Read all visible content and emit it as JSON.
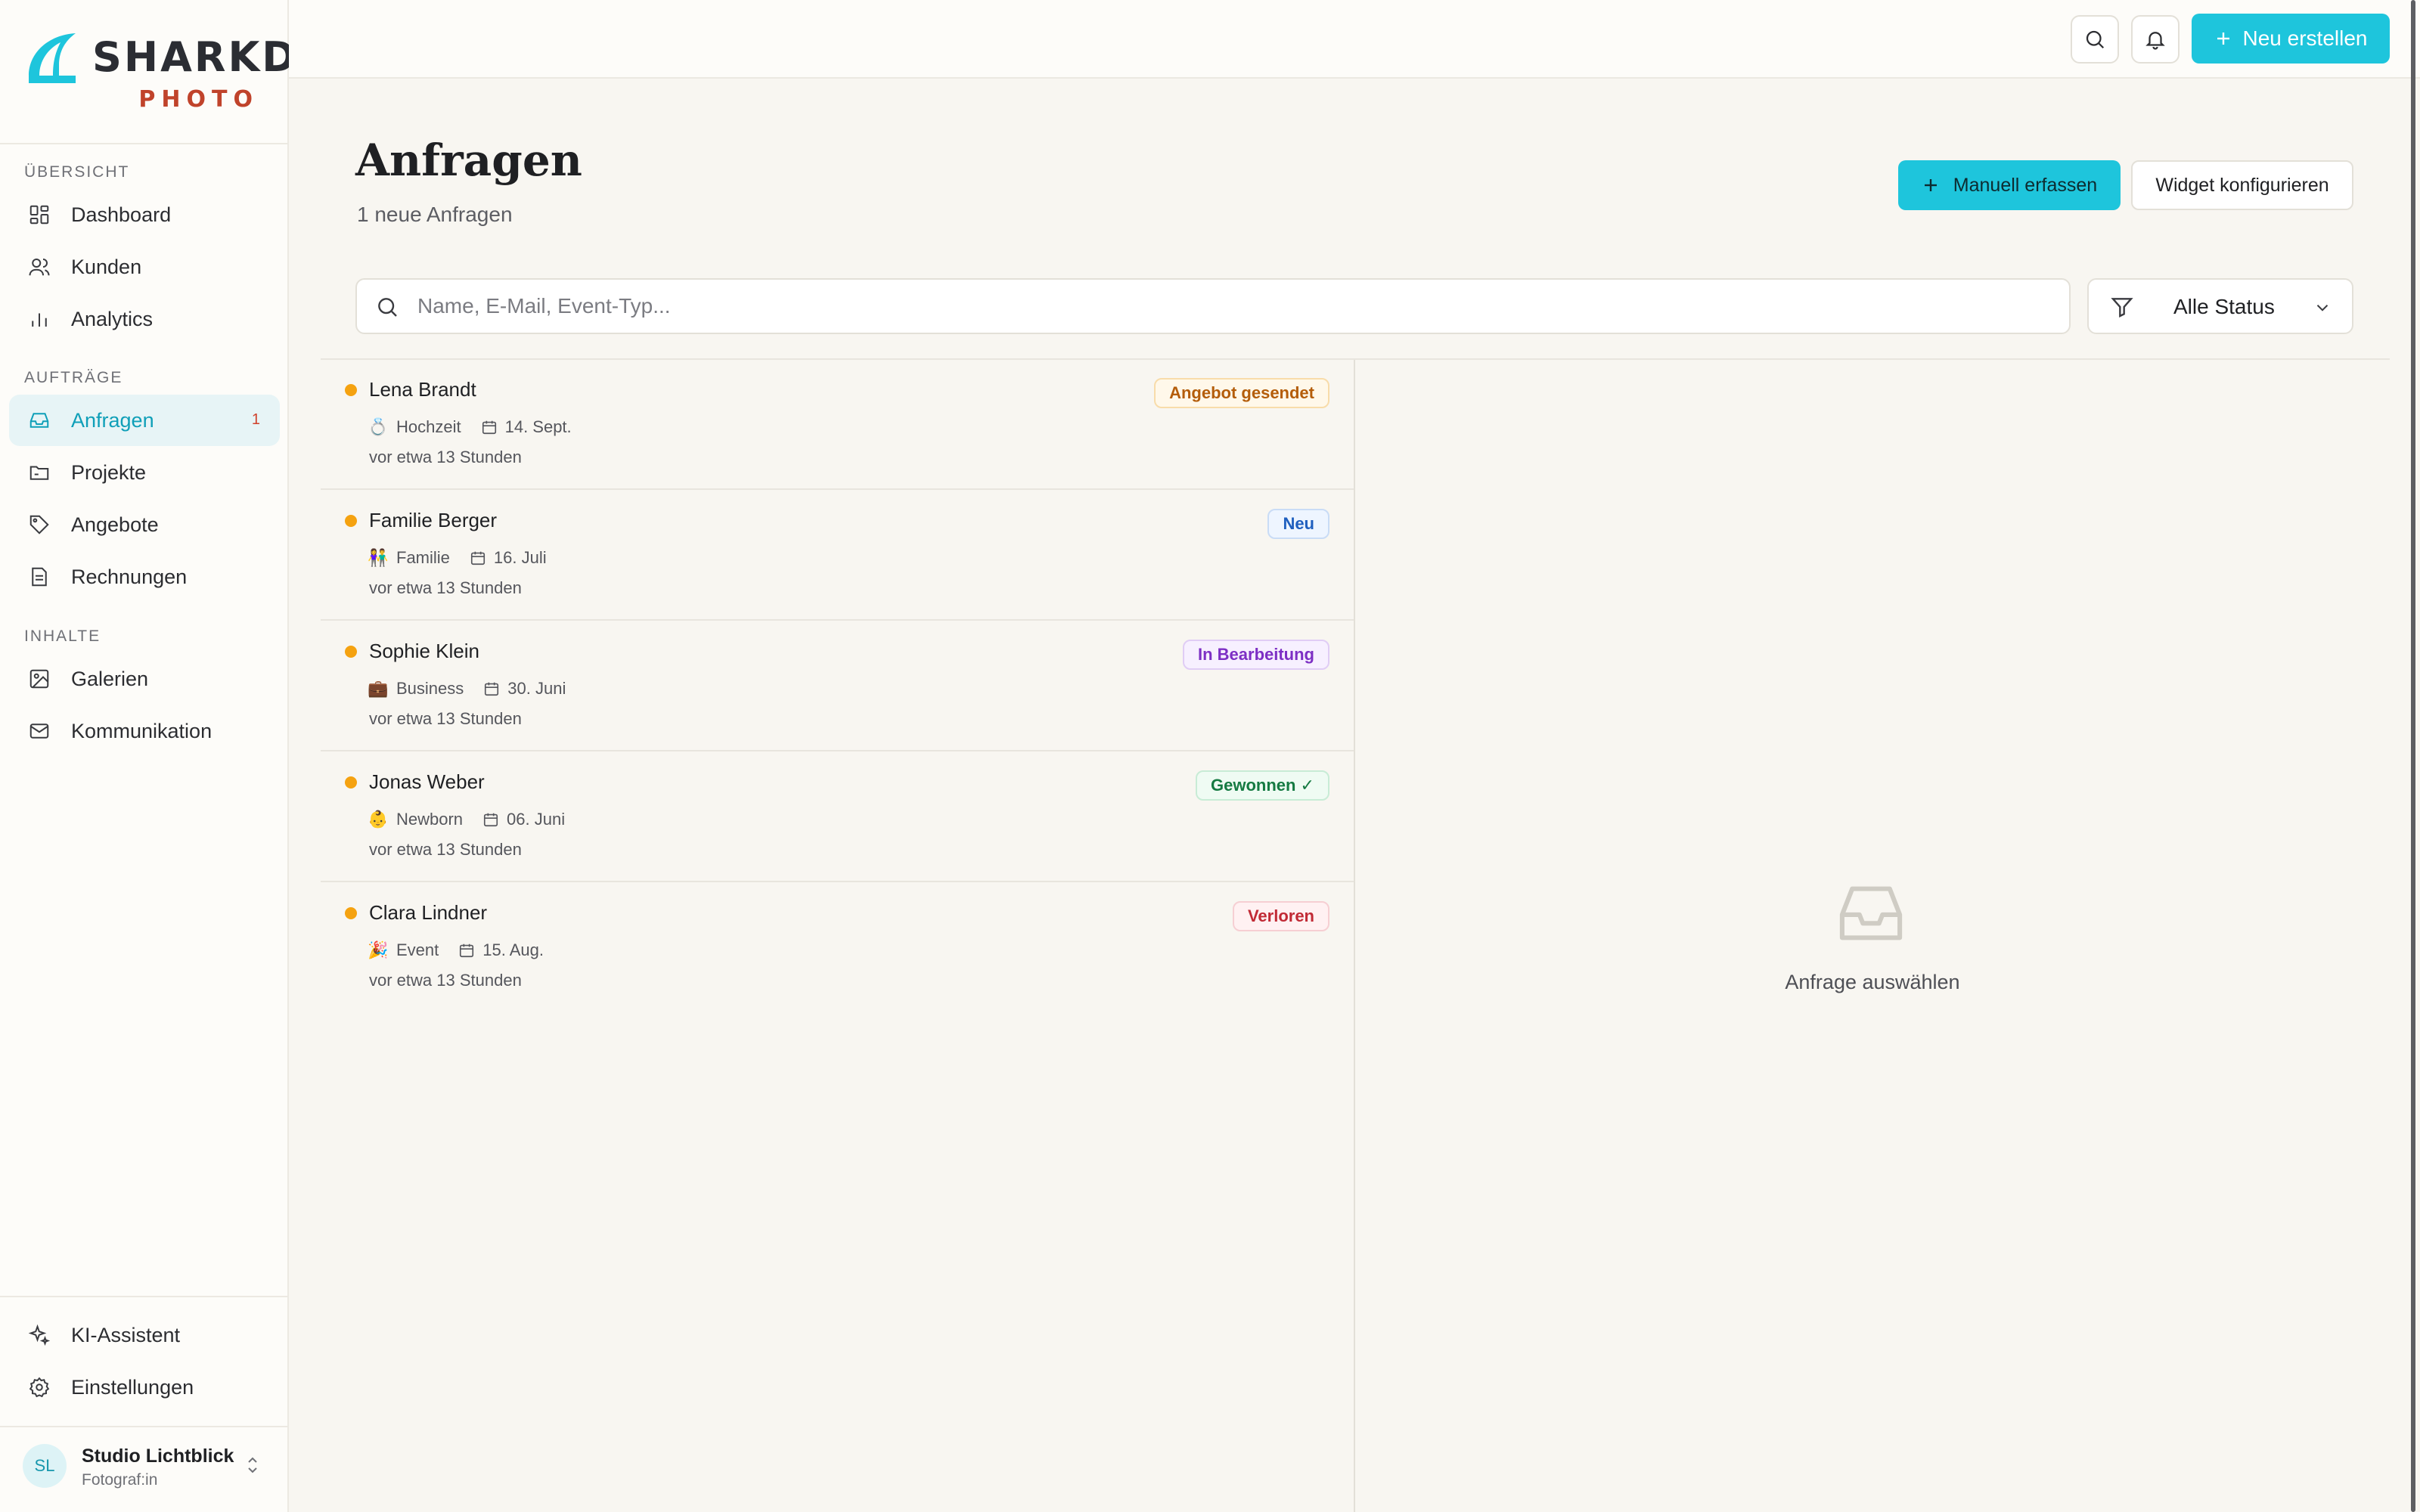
{
  "brand": {
    "name": "SHARKD",
    "sub": "PHOTO",
    "accent": "#1ec5dc",
    "sub_color": "#c0432b"
  },
  "sidebar": {
    "sections": [
      {
        "title": "ÜBERSICHT"
      },
      {
        "title": "AUFTRÄGE"
      },
      {
        "title": "INHALTE"
      }
    ],
    "items": [
      {
        "label": "Dashboard",
        "icon": "grid-icon"
      },
      {
        "label": "Kunden",
        "icon": "users-icon"
      },
      {
        "label": "Analytics",
        "icon": "bar-chart-icon"
      },
      {
        "label": "Anfragen",
        "icon": "inbox-icon",
        "badge": "1",
        "active": true
      },
      {
        "label": "Projekte",
        "icon": "folder-icon"
      },
      {
        "label": "Angebote",
        "icon": "tag-icon"
      },
      {
        "label": "Rechnungen",
        "icon": "file-icon"
      },
      {
        "label": "Galerien",
        "icon": "image-icon"
      },
      {
        "label": "Kommunikation",
        "icon": "mail-icon"
      }
    ],
    "bottom_items": [
      {
        "label": "KI-Assistent",
        "icon": "sparkles-icon"
      },
      {
        "label": "Einstellungen",
        "icon": "gear-icon"
      }
    ],
    "user": {
      "initials": "SL",
      "name": "Studio Lichtblick",
      "role": "Fotograf:in"
    }
  },
  "topbar": {
    "new_label": "Neu erstellen"
  },
  "header": {
    "title": "Anfragen",
    "subtitle": "1 neue Anfragen",
    "manual_label": "Manuell erfassen",
    "widget_label": "Widget konfigurieren"
  },
  "search": {
    "placeholder": "Name, E-Mail, Event-Typ..."
  },
  "filter": {
    "label": "Alle Status"
  },
  "inquiries": [
    {
      "name": "Lena Brandt",
      "type_emoji": "💍",
      "type": "Hochzeit",
      "date": "14. Sept.",
      "time": "vor etwa 13 Stunden",
      "status": "Angebot gesendet"
    },
    {
      "name": "Familie Berger",
      "type_emoji": "👫",
      "type": "Familie",
      "date": "16. Juli",
      "time": "vor etwa 13 Stunden",
      "status": "Neu"
    },
    {
      "name": "Sophie Klein",
      "type_emoji": "💼",
      "type": "Business",
      "date": "30. Juni",
      "time": "vor etwa 13 Stunden",
      "status": "In Bearbeitung"
    },
    {
      "name": "Jonas Weber",
      "type_emoji": "👶",
      "type": "Newborn",
      "date": "06. Juni",
      "time": "vor etwa 13 Stunden",
      "status": "Gewonnen ✓"
    },
    {
      "name": "Clara Lindner",
      "type_emoji": "🎉",
      "type": "Event",
      "date": "15. Aug.",
      "time": "vor etwa 13 Stunden",
      "status": "Verloren"
    }
  ],
  "status_colors": {
    "offer": {
      "text": "#b45d0a",
      "bg": "#fff8ea",
      "border": "#f8dcaa"
    },
    "new": {
      "text": "#1f5fbf",
      "bg": "#eef5ff",
      "border": "#c9dcf6"
    },
    "progress": {
      "text": "#7d2fc4",
      "bg": "#f7f0ff",
      "border": "#e0cdf5"
    },
    "won": {
      "text": "#157a42",
      "bg": "#effbf3",
      "border": "#c8ecd6"
    },
    "lost": {
      "text": "#c12a35",
      "bg": "#fff1f2",
      "border": "#f6cfd3"
    }
  },
  "detail": {
    "empty_text": "Anfrage auswählen",
    "icon": "inbox-empty-icon"
  }
}
